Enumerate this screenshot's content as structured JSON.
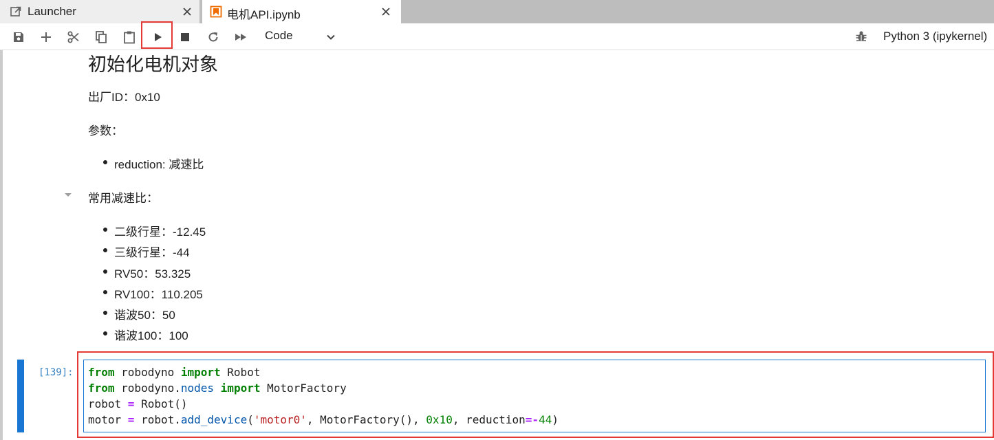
{
  "tabs": [
    {
      "label": "Launcher",
      "icon": "launcher-icon",
      "active": false
    },
    {
      "label": "电机API.ipynb",
      "icon": "notebook-icon",
      "active": true
    }
  ],
  "toolbar": {
    "buttons": [
      "save-icon",
      "plus-icon",
      "cut-icon",
      "copy-icon",
      "paste-icon",
      "run-icon",
      "stop-icon",
      "restart-icon",
      "fast-forward-icon"
    ],
    "cell_type": "Code",
    "kernel": "Python 3 (ipykernel)"
  },
  "markdown": {
    "heading": "初始化电机对象",
    "factory_id": "出厂ID：0x10",
    "params_label": "参数：",
    "params": [
      "reduction: 减速比"
    ],
    "common_label": "常用减速比：",
    "ratios": [
      "二级行星：-12.45",
      "三级行星：-44",
      "RV50：53.325",
      "RV100：110.205",
      "谐波50：50",
      "谐波100：100"
    ]
  },
  "code_cell": {
    "prompt": "[139]:",
    "lines": {
      "l1": {
        "kw1": "from",
        "t1": " robodyno ",
        "kw2": "import",
        "t2": " Robot"
      },
      "l2": {
        "kw1": "from",
        "t1": " robodyno.",
        "attr": "nodes",
        "t2": " ",
        "kw2": "import",
        "t3": " MotorFactory"
      },
      "l3": {
        "t1": "robot ",
        "op": "=",
        "t2": " Robot()"
      },
      "l4": {
        "t1": "motor ",
        "op1": "=",
        "t2": " robot.",
        "attr": "add_device",
        "t3": "(",
        "str": "'motor0'",
        "t4": ", MotorFactory(), ",
        "num1": "0x10",
        "t5": ", reduction",
        "op2": "=-",
        "num2": "44",
        "t6": ")"
      }
    }
  },
  "colors": {
    "accent": "#1976d2",
    "highlight": "#e53935",
    "keyword": "#008000",
    "string": "#ba2121",
    "operator": "#aa22ff"
  }
}
